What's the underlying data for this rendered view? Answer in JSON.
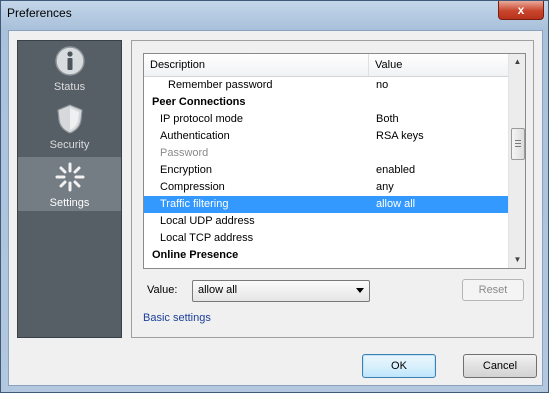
{
  "window": {
    "title": "Preferences",
    "close_glyph": "x"
  },
  "nav": {
    "items": [
      {
        "label": "Status",
        "icon": "info-icon",
        "selected": false
      },
      {
        "label": "Security",
        "icon": "shield-icon",
        "selected": false
      },
      {
        "label": "Settings",
        "icon": "settings-icon",
        "selected": true
      }
    ]
  },
  "list": {
    "headers": {
      "description": "Description",
      "value": "Value"
    },
    "rows": [
      {
        "description": "Remember password",
        "value": "no",
        "type": "indent2"
      },
      {
        "description": "Peer Connections",
        "value": "",
        "type": "section"
      },
      {
        "description": "IP protocol mode",
        "value": "Both",
        "type": "item"
      },
      {
        "description": "Authentication",
        "value": "RSA keys",
        "type": "item"
      },
      {
        "description": "Password",
        "value": "",
        "type": "disabled"
      },
      {
        "description": "Encryption",
        "value": "enabled",
        "type": "item"
      },
      {
        "description": "Compression",
        "value": "any",
        "type": "item"
      },
      {
        "description": "Traffic filtering",
        "value": "allow all",
        "type": "selected"
      },
      {
        "description": "Local UDP address",
        "value": "",
        "type": "item"
      },
      {
        "description": "Local TCP address",
        "value": "",
        "type": "item"
      },
      {
        "description": "Online Presence",
        "value": "",
        "type": "section"
      }
    ]
  },
  "editor": {
    "value_label": "Value:",
    "value_selected": "allow all",
    "reset_label": "Reset"
  },
  "links": {
    "basic_settings": "Basic settings"
  },
  "buttons": {
    "ok": "OK",
    "cancel": "Cancel"
  },
  "colors": {
    "selection": "#3399ff",
    "nav_bg": "#565e66",
    "link": "#1c3f9c"
  }
}
